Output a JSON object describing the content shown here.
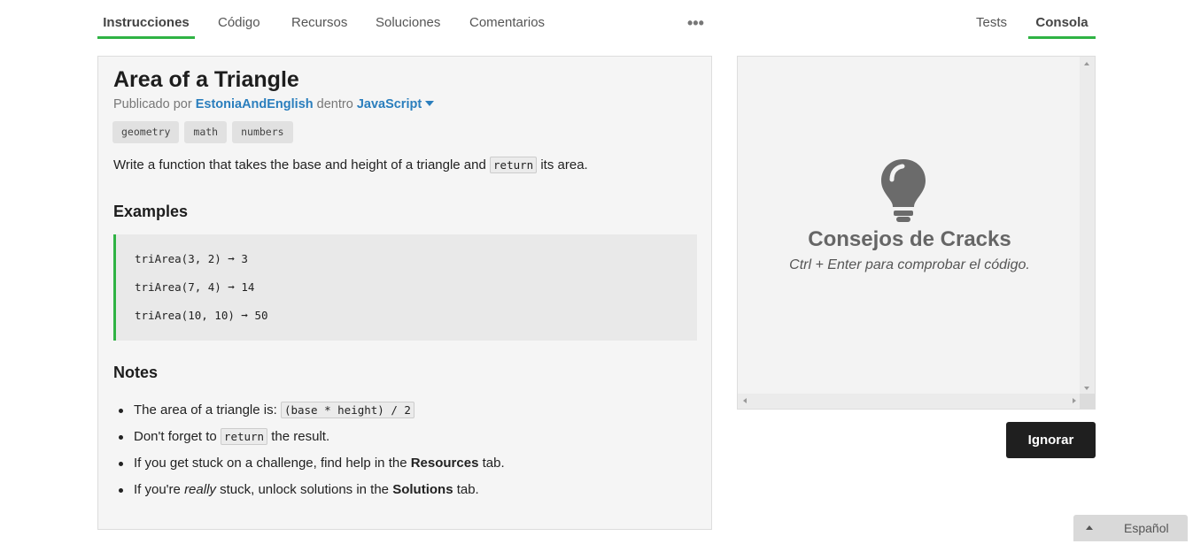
{
  "tabs_left": [
    {
      "label": "Instrucciones",
      "active": true
    },
    {
      "label": "Código",
      "active": false
    },
    {
      "label": "Recursos",
      "active": false
    },
    {
      "label": "Soluciones",
      "active": false
    },
    {
      "label": "Comentarios",
      "active": false
    }
  ],
  "more_label": "•••",
  "tabs_right": [
    {
      "label": "Tests",
      "active": false
    },
    {
      "label": "Consola",
      "active": true
    }
  ],
  "challenge": {
    "title": "Area of a Triangle",
    "published_prefix": "Publicado por",
    "author": "EstoniaAndEnglish",
    "within": "dentro",
    "language": "JavaScript",
    "tags": [
      "geometry",
      "math",
      "numbers"
    ],
    "description_before": "Write a function that takes the base and height of a triangle and",
    "description_code": "return",
    "description_after": "its area.",
    "examples_heading": "Examples",
    "examples": [
      "triArea(3, 2) ➞ 3",
      "triArea(7, 4) ➞ 14",
      "triArea(10, 10) ➞ 50"
    ],
    "notes_heading": "Notes",
    "notes": {
      "n1_text": "The area of a triangle is:",
      "n1_code": "(base * height) / 2",
      "n2_before": "Don't forget to",
      "n2_code": "return",
      "n2_after": "the result.",
      "n3_before": "If you get stuck on a challenge, find help in the",
      "n3_bold": "Resources",
      "n3_after": "tab.",
      "n4_before": "If you're",
      "n4_italic": "really",
      "n4_mid": "stuck, unlock solutions in the",
      "n4_bold": "Solutions",
      "n4_after": "tab."
    }
  },
  "console": {
    "icon": "lightbulb-icon",
    "title": "Consejos de Cracks",
    "hint": "Ctrl + Enter para comprobar el código."
  },
  "ignore_button": "Ignorar",
  "language_selector": "Español",
  "colors": {
    "accent_green": "#2fb344",
    "link_blue": "#2a7ebd",
    "dark_button": "#1f1f1f"
  }
}
